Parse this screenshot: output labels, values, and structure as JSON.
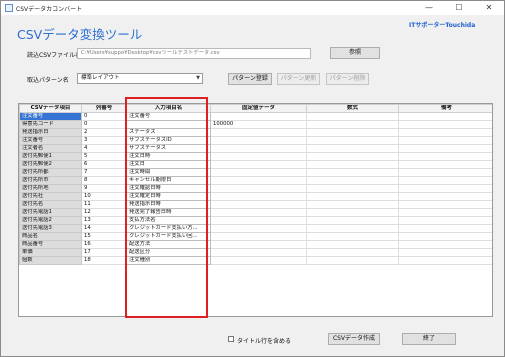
{
  "window": {
    "title": "CSVデータカコンバート",
    "controls": {
      "minimize": "—",
      "maximize": "☐",
      "close": "✕"
    }
  },
  "header": {
    "heading": "CSVデータ変換ツール",
    "brand": "ITサポーターTouchida"
  },
  "csv_file": {
    "label": "読込CSVファイル名",
    "value": "C:¥Users¥suppo¥Desktop¥csvツールテストデータ.csv",
    "browse_label": "参照"
  },
  "pattern": {
    "label": "取込パターン名",
    "selected": "標準レイアウト",
    "register_label": "パターン登録",
    "update_label": "パターン更新",
    "delete_label": "パターン削除"
  },
  "grid": {
    "columns": [
      "CSVデータ項目",
      "列番号",
      "入力項目名",
      "固定値データ",
      "数式",
      "備考"
    ],
    "rows": [
      {
        "item": "注文番号",
        "col": "0",
        "input": "注文番号",
        "fixed": ""
      },
      {
        "item": "得意先コード",
        "col": "0",
        "input": "",
        "fixed": "100000"
      },
      {
        "item": "発送指示日",
        "col": "2",
        "input": "ステータス",
        "fixed": ""
      },
      {
        "item": "注文番号",
        "col": "3",
        "input": "サブステータスID",
        "fixed": ""
      },
      {
        "item": "注文者名",
        "col": "4",
        "input": "サブステータス",
        "fixed": ""
      },
      {
        "item": "送付先郵便1",
        "col": "5",
        "input": "注文日時",
        "fixed": ""
      },
      {
        "item": "送付先郵便2",
        "col": "6",
        "input": "注文日",
        "fixed": ""
      },
      {
        "item": "送付先所都",
        "col": "7",
        "input": "注文時間",
        "fixed": ""
      },
      {
        "item": "送付先所市",
        "col": "8",
        "input": "キャンセル期限日",
        "fixed": ""
      },
      {
        "item": "送付先所地",
        "col": "9",
        "input": "注文確認日時",
        "fixed": ""
      },
      {
        "item": "送付先社",
        "col": "10",
        "input": "注文確定日時",
        "fixed": ""
      },
      {
        "item": "送付先名",
        "col": "11",
        "input": "発送指示日時",
        "fixed": ""
      },
      {
        "item": "送付先電話1",
        "col": "12",
        "input": "発送完了報告日時",
        "fixed": ""
      },
      {
        "item": "送付先電話2",
        "col": "13",
        "input": "支払方法名",
        "fixed": ""
      },
      {
        "item": "送付先電話3",
        "col": "14",
        "input": "クレジットカード支払い方...",
        "fixed": ""
      },
      {
        "item": "商品名",
        "col": "15",
        "input": "クレジットカード支払い回...",
        "fixed": ""
      },
      {
        "item": "商品番号",
        "col": "16",
        "input": "配送方法",
        "fixed": ""
      },
      {
        "item": "単価",
        "col": "17",
        "input": "配送区分",
        "fixed": ""
      },
      {
        "item": "個数",
        "col": "18",
        "input": "注文種別",
        "fixed": ""
      }
    ]
  },
  "footer": {
    "include_title_label": "タイトル行を含める",
    "create_csv_label": "CSVデータ作成",
    "exit_label": "終了"
  },
  "colors": {
    "heading": "#2a6fd1",
    "selection": "#3574d2",
    "highlight_box": "#e02020"
  }
}
